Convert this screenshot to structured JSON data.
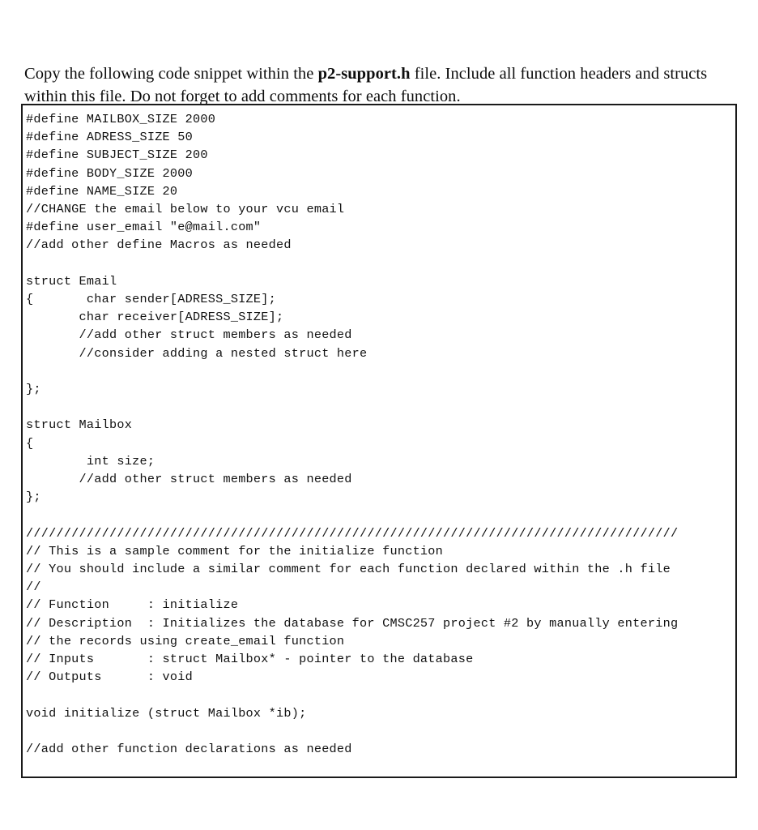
{
  "document": {
    "intro": {
      "before_bold": "Copy the following code snippet within the ",
      "bold": "p2-support.h",
      "after_bold": " file. Include all function headers and structs within this file. Do not forget to add comments for each function."
    },
    "code_block": {
      "language": "c",
      "filename": "p2-support.h",
      "lines": [
        "#define MAILBOX_SIZE 2000",
        "#define ADRESS_SIZE 50",
        "#define SUBJECT_SIZE 200",
        "#define BODY_SIZE 2000",
        "#define NAME_SIZE 20",
        "//CHANGE the email below to your vcu email",
        "#define user_email \"e@mail.com\"",
        "//add other define Macros as needed",
        "",
        "struct Email",
        "{       char sender[ADRESS_SIZE];",
        "       char receiver[ADRESS_SIZE];",
        "       //add other struct members as needed",
        "       //consider adding a nested struct here",
        "",
        "};",
        "",
        "struct Mailbox",
        "{",
        "        int size;",
        "       //add other struct members as needed",
        "};",
        "",
        "//////////////////////////////////////////////////////////////////////////////////////",
        "// This is a sample comment for the initialize function",
        "// You should include a similar comment for each function declared within the .h file",
        "//",
        "// Function     : initialize",
        "// Description  : Initializes the database for CMSC257 project #2 by manually entering",
        "// the records using create_email function",
        "// Inputs       : struct Mailbox* - pointer to the database",
        "// Outputs      : void",
        "",
        "void initialize (struct Mailbox *ib);",
        "",
        "//add other function declarations as needed"
      ]
    },
    "colors": {
      "page_background": "#ffffff",
      "text": "#0d0d0d",
      "code_text": "#111111",
      "code_border": "#1a1a1a"
    }
  }
}
